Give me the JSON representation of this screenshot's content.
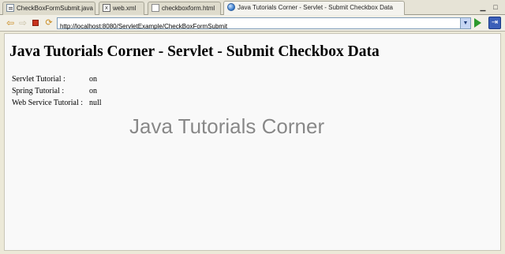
{
  "tabs": [
    {
      "label": "CheckBoxFormSubmit.java",
      "icon": "java-file-icon",
      "active": false
    },
    {
      "label": "web.xml",
      "icon": "xml-file-icon",
      "active": false
    },
    {
      "label": "checkboxform.html",
      "icon": "html-file-icon",
      "active": false
    },
    {
      "label": "Java Tutorials Corner - Servlet - Submit Checkbox Data",
      "icon": "globe-icon",
      "active": true
    }
  ],
  "tab_controls": {
    "minimize": "▁",
    "maximize": "□"
  },
  "toolbar": {
    "back": "⇦",
    "forward": "⇨",
    "refresh": "⟳",
    "url": "http://localhost:8080/ServletExample/CheckBoxFormSubmit",
    "go": "go",
    "nav": "⇥"
  },
  "page": {
    "heading": "Java Tutorials Corner - Servlet - Submit Checkbox Data",
    "rows": [
      {
        "label": "Servlet Tutorial :",
        "value": "on"
      },
      {
        "label": "Spring Tutorial :",
        "value": "on"
      },
      {
        "label": "Web Service Tutorial :",
        "value": "null"
      }
    ],
    "watermark": "Java Tutorials Corner"
  },
  "colors": {
    "window_bg": "#ece9d8",
    "page_bg": "#f9f9f9",
    "go_arrow": "#2d9a2d",
    "stop": "#c8331e"
  }
}
